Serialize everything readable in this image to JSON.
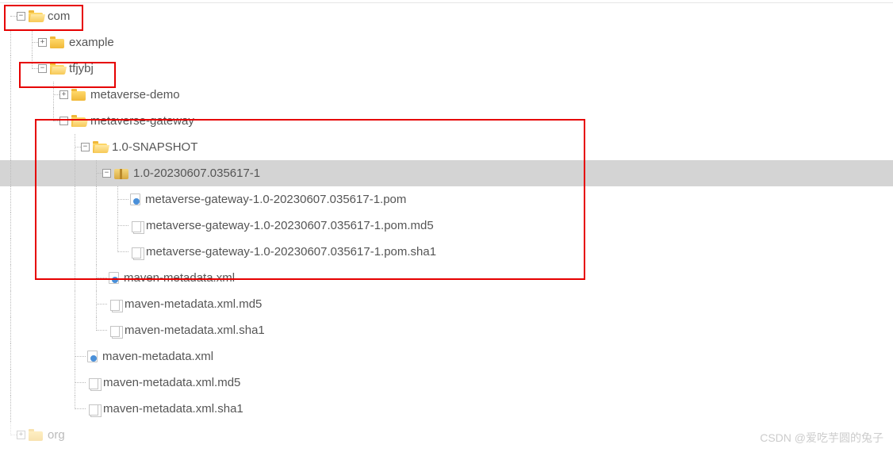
{
  "tree": {
    "com": "com",
    "example": "example",
    "tfjybj": "tfjybj",
    "metaverse_demo": "metaverse-demo",
    "metaverse_gateway": "metaverse-gateway",
    "snapshot": "1.0-SNAPSHOT",
    "build": "1.0-20230607.035617-1",
    "pom": "metaverse-gateway-1.0-20230607.035617-1.pom",
    "pom_md5": "metaverse-gateway-1.0-20230607.035617-1.pom.md5",
    "pom_sha1": "metaverse-gateway-1.0-20230607.035617-1.pom.sha1",
    "meta_xml": "maven-metadata.xml",
    "meta_md5": "maven-metadata.xml.md5",
    "meta_sha1": "maven-metadata.xml.sha1",
    "meta2_xml": "maven-metadata.xml",
    "meta2_md5": "maven-metadata.xml.md5",
    "meta2_sha1": "maven-metadata.xml.sha1",
    "org": "org"
  },
  "watermark": "CSDN @爱吃芋圆的兔子",
  "toggle": {
    "plus": "+",
    "minus": "−"
  }
}
